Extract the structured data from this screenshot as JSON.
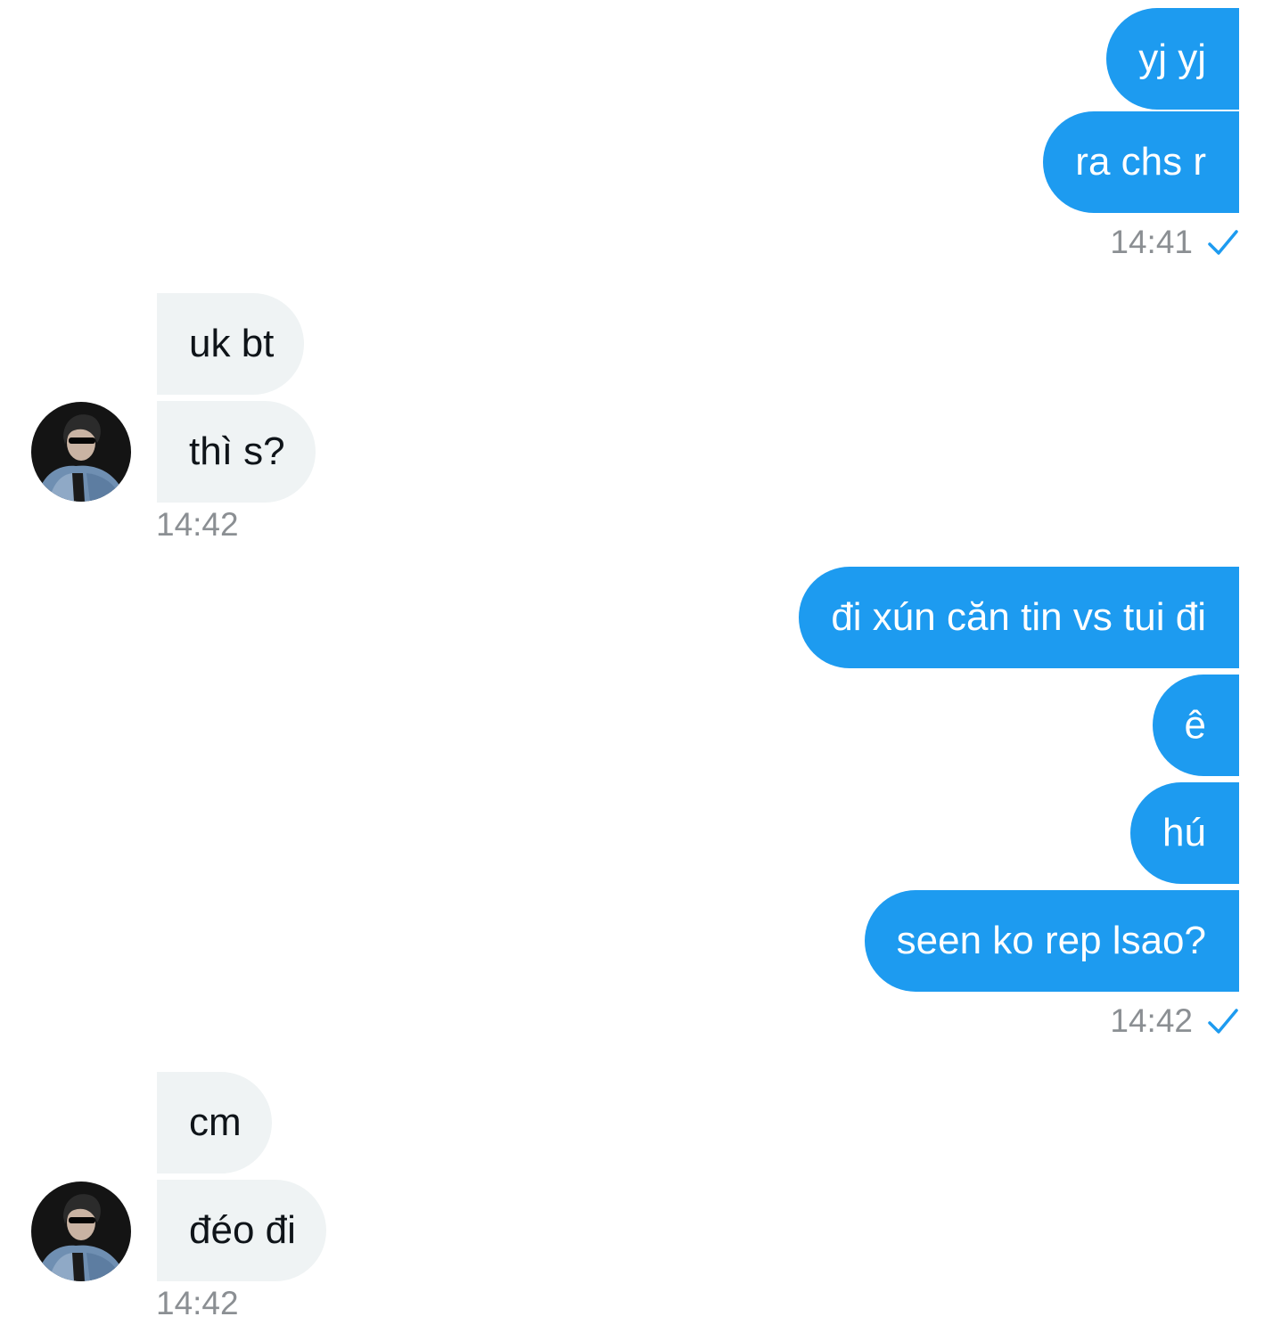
{
  "accent_color": "#1d9bf0",
  "incoming_bubble_color": "#eff3f4",
  "groups": [
    {
      "sender": "me",
      "messages": [
        "yj yj",
        "ra chs r"
      ],
      "time": "14:41",
      "status_icon": "check-icon"
    },
    {
      "sender": "contact",
      "messages": [
        "uk bt",
        "thì s?"
      ],
      "time": "14:42",
      "avatar_icon": "contact-avatar"
    },
    {
      "sender": "me",
      "messages": [
        "đi xún căn tin vs tui đi",
        "ê",
        "hú",
        "seen ko rep lsao?"
      ],
      "time": "14:42",
      "status_icon": "check-icon"
    },
    {
      "sender": "contact",
      "messages": [
        "cm",
        "đéo đi"
      ],
      "time": "14:42",
      "avatar_icon": "contact-avatar"
    }
  ]
}
